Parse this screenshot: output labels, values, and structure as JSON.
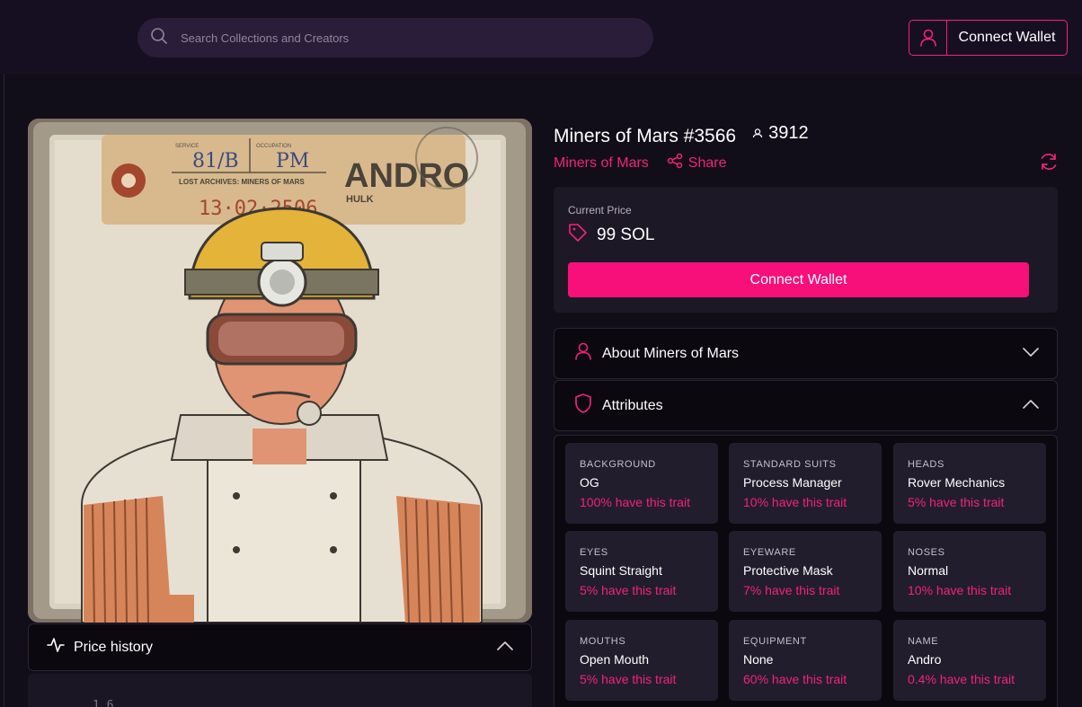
{
  "header": {
    "search_placeholder": "Search Collections and Creators",
    "connect_label": "Connect Wallet"
  },
  "nft": {
    "title": "Miners of Mars #3566",
    "holders": "3912",
    "collection": "Miners of Mars",
    "share_label": "Share",
    "art_text": {
      "service_label": "SERVICE",
      "service_value": "81/B",
      "occupation_label": "OCCUPATION",
      "occupation_value": "PM",
      "archive": "LOST ARCHIVES: MINERS OF MARS",
      "date": "13·02·2506",
      "name": "ANDRO",
      "subname": "HULK"
    }
  },
  "price": {
    "label": "Current Price",
    "amount": "99 SOL",
    "button": "Connect Wallet"
  },
  "sections": {
    "about": "About Miners of Mars",
    "attributes": "Attributes",
    "price_history": "Price history",
    "price_history_tick": "1.6"
  },
  "attributes": [
    {
      "type": "BACKGROUND",
      "value": "OG",
      "pct": "100% have this trait"
    },
    {
      "type": "STANDARD SUITS",
      "value": "Process Manager",
      "pct": "10% have this trait"
    },
    {
      "type": "HEADS",
      "value": "Rover Mechanics",
      "pct": "5% have this trait"
    },
    {
      "type": "EYES",
      "value": "Squint Straight",
      "pct": "5% have this trait"
    },
    {
      "type": "EYEWARE",
      "value": "Protective Mask",
      "pct": "7% have this trait"
    },
    {
      "type": "NOSES",
      "value": "Normal",
      "pct": "10% have this trait"
    },
    {
      "type": "MOUTHS",
      "value": "Open Mouth",
      "pct": "5% have this trait"
    },
    {
      "type": "EQUIPMENT",
      "value": "None",
      "pct": "60% have this trait"
    },
    {
      "type": "NAME",
      "value": "Andro",
      "pct": "0.4% have this trait"
    }
  ],
  "colors": {
    "accent": "#f0237a",
    "button": "#f70f7a",
    "background": "#120e19",
    "card": "#221d2d"
  }
}
